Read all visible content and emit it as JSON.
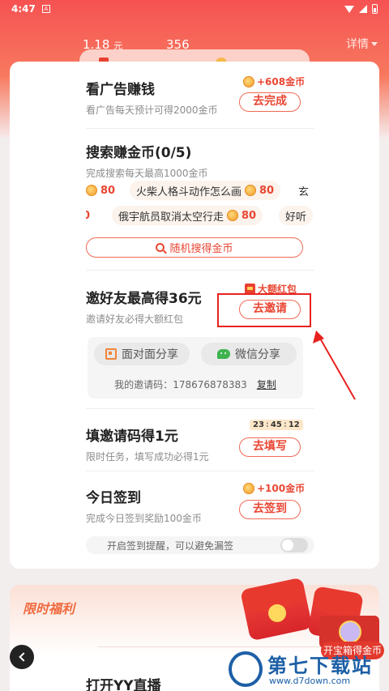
{
  "status_bar": {
    "time": "4:47",
    "notif": "A"
  },
  "header": {
    "money_value": "1.18",
    "money_unit": "元",
    "coins_value": "356",
    "detail_label": "详情"
  },
  "tasks": {
    "ads": {
      "title": "看广告赚钱",
      "desc": "看广告每天预计可得2000金币",
      "reward": "+608金币",
      "button": "去完成"
    },
    "search": {
      "title": "搜索赚金币(0/5)",
      "desc": "完成搜索每天最高1000金币",
      "row1": [
        {
          "num": "80"
        },
        {
          "text": "火柴人格斗动作怎么画",
          "num": "80"
        },
        {
          "text": "玄"
        }
      ],
      "row2": [
        {
          "num": "0"
        },
        {
          "text": "俄宇航员取消太空行走",
          "num": "80"
        },
        {
          "text": "好听"
        }
      ],
      "random_button": "随机搜得金币"
    },
    "invite": {
      "title": "邀好友最高得36元",
      "desc": "邀请好友必得大额红包",
      "badge": "大额红包",
      "button": "去邀请",
      "share_face": "面对面分享",
      "share_wechat": "微信分享",
      "code_label": "我的邀请码：",
      "code_value": "178676878383",
      "copy_label": "复制"
    },
    "fill_code": {
      "title": "填邀请码得1元",
      "desc": "限时任务，填写成功必得1元",
      "timer_h": "23",
      "timer_m": "45",
      "timer_s": "12",
      "button": "去填写"
    },
    "checkin": {
      "title": "今日签到",
      "desc": "完成今日签到奖励100金币",
      "reward": "+100金币",
      "button": "去签到",
      "reminder": "开启签到提醒，可以避免漏签"
    }
  },
  "welfare": {
    "title": "限时福利",
    "chest_label": "开宝箱得金币",
    "yy_task": "打开YY直播"
  },
  "watermark": {
    "title": "第七下载站",
    "url": "www.d7down.com"
  },
  "colors": {
    "accent": "#e94734",
    "header": "#f65252",
    "annotation": "#e8231f"
  }
}
